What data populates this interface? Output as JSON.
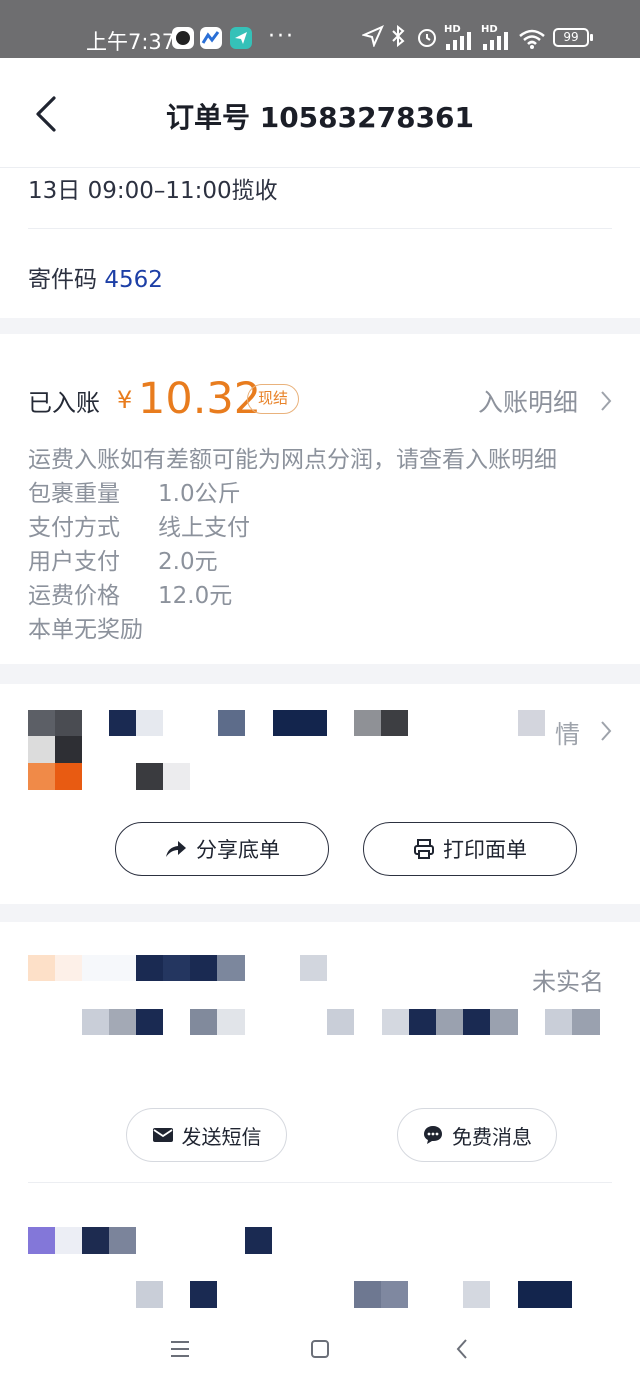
{
  "status_bar": {
    "time": "上午7:37",
    "more": "···",
    "hd1": "HD",
    "hd2": "HD",
    "battery": "99",
    "icons": [
      "circle-app-icon",
      "chart-app-icon",
      "send-app-icon",
      "location-arrow-icon",
      "bluetooth-icon",
      "alarm-icon",
      "signal-icon",
      "signal-icon",
      "wifi-icon",
      "battery-icon"
    ]
  },
  "header": {
    "title": "订单号 10583278361"
  },
  "pickup": {
    "time_text": "13日 09:00–11:00揽收"
  },
  "send_code": {
    "label": "寄件码",
    "value": "4562"
  },
  "account": {
    "label": "已入账",
    "currency": "¥",
    "amount": "10.32",
    "badge": "现结",
    "link": "入账明细",
    "notice": "运费入账如有差额可能为网点分润，请查看入账明细",
    "rows": [
      {
        "label": "包裹重量",
        "value": "1.0公斤"
      },
      {
        "label": "支付方式",
        "value": "线上支付"
      },
      {
        "label": "用户支付",
        "value": "2.0元"
      },
      {
        "label": "运费价格",
        "value": "12.0元"
      }
    ],
    "reward": "本单无奖励"
  },
  "package": {
    "detail_tail": "情",
    "share_button": "分享底单",
    "print_button": "打印面单"
  },
  "sender": {
    "status": "未实名",
    "sms_button": "发送短信",
    "message_button": "免费消息"
  },
  "colors": {
    "accent_orange": "#e87c1e",
    "link_blue": "#1d3fa6",
    "status_bar": "#6e6e70"
  }
}
